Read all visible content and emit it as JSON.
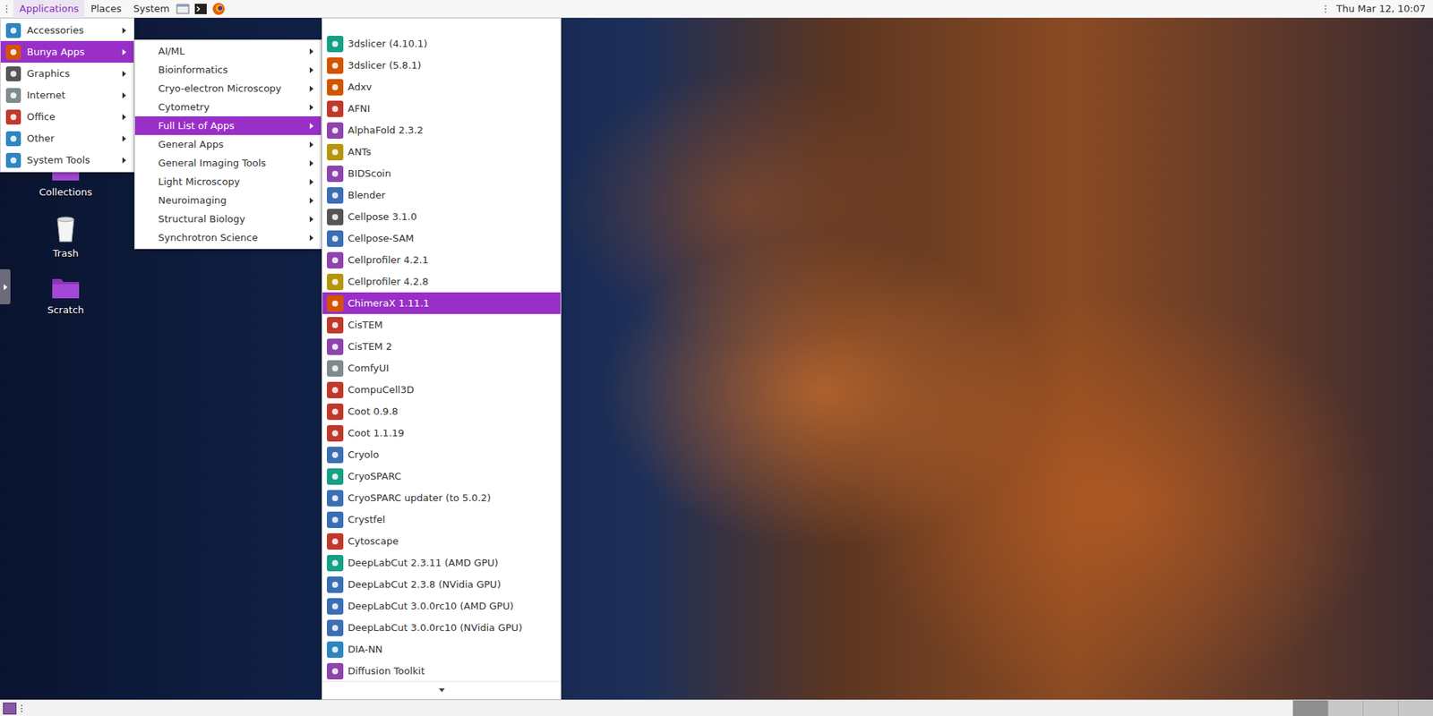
{
  "top_panel": {
    "menus": [
      {
        "label": "Applications",
        "selected": true
      },
      {
        "label": "Places",
        "selected": false
      },
      {
        "label": "System",
        "selected": false
      }
    ],
    "clock": "Thu Mar 12, 10:07"
  },
  "desktop_icons": [
    {
      "label": "Collections",
      "kind": "folder"
    },
    {
      "label": "Trash",
      "kind": "trash"
    },
    {
      "label": "Scratch",
      "kind": "folder"
    }
  ],
  "menus": [
    {
      "items": [
        {
          "label": "Accessories",
          "selected": false,
          "submenu": true
        },
        {
          "label": "Bunya Apps",
          "selected": true,
          "submenu": true
        },
        {
          "label": "Graphics",
          "selected": false,
          "submenu": true
        },
        {
          "label": "Internet",
          "selected": false,
          "submenu": true
        },
        {
          "label": "Office",
          "selected": false,
          "submenu": true
        },
        {
          "label": "Other",
          "selected": false,
          "submenu": true
        },
        {
          "label": "System Tools",
          "selected": false,
          "submenu": true
        }
      ]
    },
    {
      "items": [
        {
          "label": "AI/ML",
          "selected": false,
          "submenu": true
        },
        {
          "label": "Bioinformatics",
          "selected": false,
          "submenu": true
        },
        {
          "label": "Cryo-electron Microscopy",
          "selected": false,
          "submenu": true
        },
        {
          "label": "Cytometry",
          "selected": false,
          "submenu": true
        },
        {
          "label": "Full List of Apps",
          "selected": true,
          "submenu": true
        },
        {
          "label": "General Apps",
          "selected": false,
          "submenu": true
        },
        {
          "label": "General Imaging Tools",
          "selected": false,
          "submenu": true
        },
        {
          "label": "Light Microscopy",
          "selected": false,
          "submenu": true
        },
        {
          "label": "Neuroimaging",
          "selected": false,
          "submenu": true
        },
        {
          "label": "Structural Biology",
          "selected": false,
          "submenu": true
        },
        {
          "label": "Synchrotron Science",
          "selected": false,
          "submenu": true
        }
      ]
    },
    {
      "items": [
        {
          "label": "3dslicer (4.10.1)",
          "selected": false,
          "submenu": false
        },
        {
          "label": "3dslicer (5.8.1)",
          "selected": false,
          "submenu": false
        },
        {
          "label": "Adxv",
          "selected": false,
          "submenu": false
        },
        {
          "label": "AFNI",
          "selected": false,
          "submenu": false
        },
        {
          "label": "AlphaFold 2.3.2",
          "selected": false,
          "submenu": false
        },
        {
          "label": "ANTs",
          "selected": false,
          "submenu": false
        },
        {
          "label": "BIDScoin",
          "selected": false,
          "submenu": false
        },
        {
          "label": "Blender",
          "selected": false,
          "submenu": false
        },
        {
          "label": "Cellpose 3.1.0",
          "selected": false,
          "submenu": false
        },
        {
          "label": "Cellpose-SAM",
          "selected": false,
          "submenu": false
        },
        {
          "label": "Cellprofiler 4.2.1",
          "selected": false,
          "submenu": false
        },
        {
          "label": "Cellprofiler 4.2.8",
          "selected": false,
          "submenu": false
        },
        {
          "label": "ChimeraX 1.11.1",
          "selected": true,
          "submenu": false
        },
        {
          "label": "CisTEM",
          "selected": false,
          "submenu": false
        },
        {
          "label": "CisTEM 2",
          "selected": false,
          "submenu": false
        },
        {
          "label": "ComfyUI",
          "selected": false,
          "submenu": false
        },
        {
          "label": "CompuCell3D",
          "selected": false,
          "submenu": false
        },
        {
          "label": "Coot 0.9.8",
          "selected": false,
          "submenu": false
        },
        {
          "label": "Coot 1.1.19",
          "selected": false,
          "submenu": false
        },
        {
          "label": "Cryolo",
          "selected": false,
          "submenu": false
        },
        {
          "label": "CryoSPARC",
          "selected": false,
          "submenu": false
        },
        {
          "label": "CryoSPARC updater (to 5.0.2)",
          "selected": false,
          "submenu": false
        },
        {
          "label": "Crystfel",
          "selected": false,
          "submenu": false
        },
        {
          "label": "Cytoscape",
          "selected": false,
          "submenu": false
        },
        {
          "label": "DeepLabCut 2.3.11 (AMD GPU)",
          "selected": false,
          "submenu": false
        },
        {
          "label": "DeepLabCut 2.3.8 (NVidia GPU)",
          "selected": false,
          "submenu": false
        },
        {
          "label": "DeepLabCut 3.0.0rc10 (AMD GPU)",
          "selected": false,
          "submenu": false
        },
        {
          "label": "DeepLabCut 3.0.0rc10 (NVidia GPU)",
          "selected": false,
          "submenu": false
        },
        {
          "label": "DIA-NN",
          "selected": false,
          "submenu": false
        },
        {
          "label": "Diffusion Toolkit",
          "selected": false,
          "submenu": false
        }
      ]
    }
  ],
  "bottom_panel": {
    "workspaces": [
      {
        "selected": true
      },
      {
        "selected": false
      },
      {
        "selected": false
      },
      {
        "selected": false
      }
    ]
  }
}
